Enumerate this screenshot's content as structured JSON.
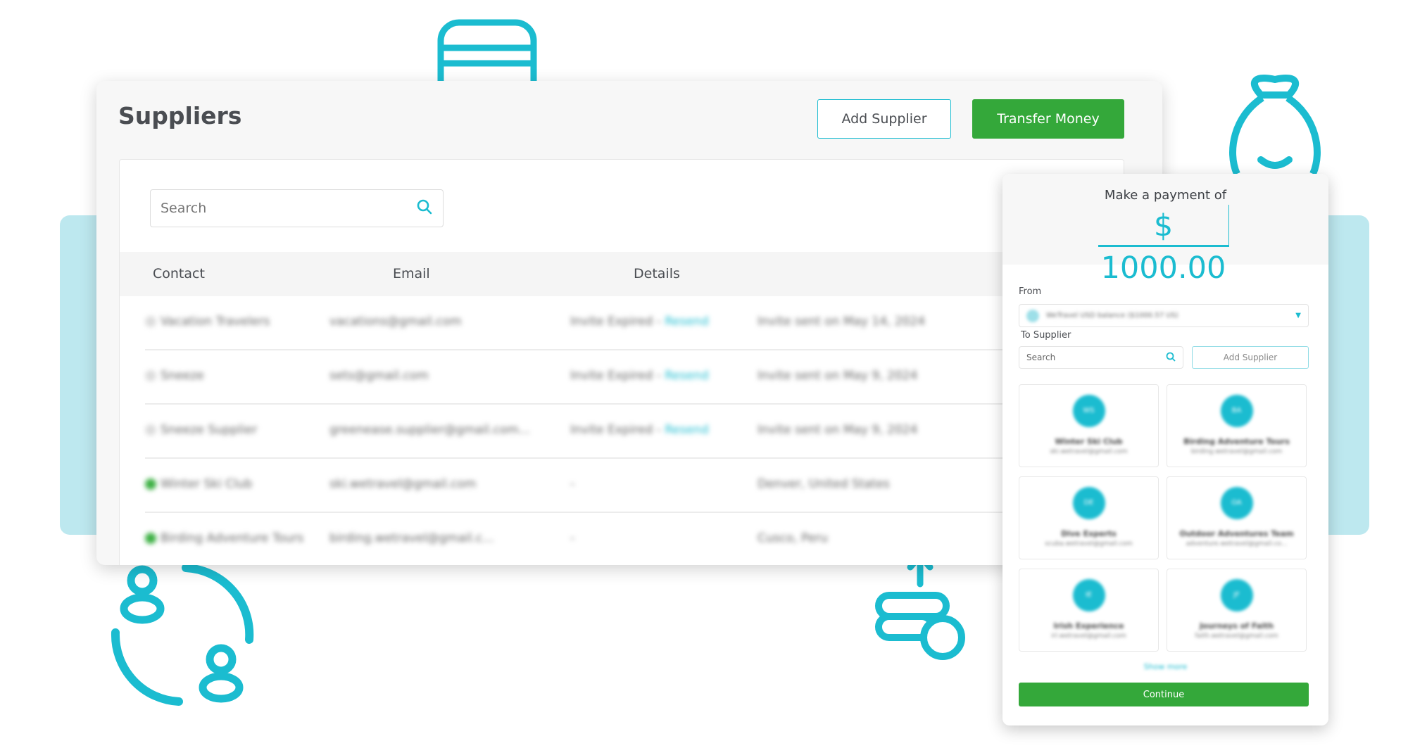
{
  "colors": {
    "accent": "#1bbcd0",
    "primary_button": "#34a83a",
    "background_band": "#bde8ef"
  },
  "suppliers_page": {
    "title": "Suppliers",
    "add_supplier_label": "Add Supplier",
    "transfer_money_label": "Transfer Money",
    "search_placeholder": "Search",
    "columns": [
      "Contact",
      "Email",
      "Details"
    ],
    "rows": [
      {
        "contact": "Vacation Travelers",
        "email": "vacations@gmail.com",
        "details": "Invite Expired -",
        "action": "Resend",
        "extra": "Invite sent on May 14, 2024",
        "status": "pending"
      },
      {
        "contact": "Sneeze",
        "email": "sets@gmail.com",
        "details": "Invite Expired -",
        "action": "Resend",
        "extra": "Invite sent on May 9, 2024",
        "status": "pending"
      },
      {
        "contact": "Sneeze Supplier",
        "email": "greenease.supplier@gmail.com...",
        "details": "Invite Expired -",
        "action": "Resend",
        "extra": "Invite sent on May 9, 2024",
        "status": "pending"
      },
      {
        "contact": "Winter Ski Club",
        "email": "ski.wetravel@gmail.com",
        "details": "-",
        "action": "",
        "extra": "Denver, United States",
        "status": "active"
      },
      {
        "contact": "Birding Adventure Tours",
        "email": "birding.wetravel@gmail.c...",
        "details": "-",
        "action": "",
        "extra": "Cusco, Peru",
        "status": "active"
      }
    ]
  },
  "payment_panel": {
    "heading": "Make a payment of",
    "amount": "$ 1000.00",
    "from_label": "From",
    "from_value": "WeTravel USD balance ($1000.57 US)",
    "to_label": "To Supplier",
    "search_placeholder": "Search",
    "add_supplier_label": "Add Supplier",
    "suppliers": [
      {
        "initials": "WS",
        "name": "Winter Ski Club",
        "email": "ski.wetravel@gmail.com"
      },
      {
        "initials": "BA",
        "name": "Birding Adventure Tours",
        "email": "birding.wetravel@gmail.com"
      },
      {
        "initials": "DE",
        "name": "Dive Experts",
        "email": "scuba.wetravel@gmail.com"
      },
      {
        "initials": "OA",
        "name": "Outdoor Adventures Team",
        "email": "adventure.wetravel@gmail.co..."
      },
      {
        "initials": "IE",
        "name": "Irish Experience",
        "email": "irl.wetravel@gmail.com"
      },
      {
        "initials": "JF",
        "name": "Journeys of Faith",
        "email": "faith.wetravel@gmail.com"
      }
    ],
    "show_more_label": "Show more",
    "continue_label": "Continue"
  }
}
